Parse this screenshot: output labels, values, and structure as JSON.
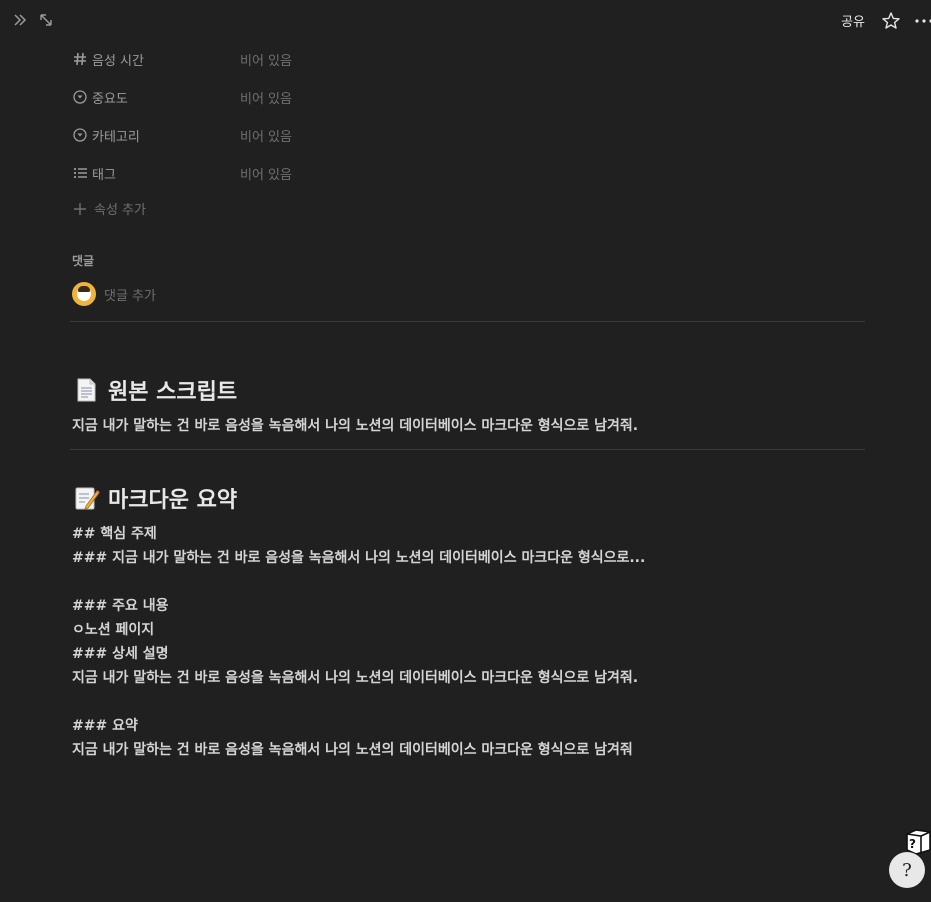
{
  "topbar": {
    "share_label": "공유"
  },
  "properties": [
    {
      "icon": "hash-icon",
      "name": "음성 시간",
      "value": "비어 있음"
    },
    {
      "icon": "select-icon",
      "name": "중요도",
      "value": "비어 있음"
    },
    {
      "icon": "select-icon",
      "name": "카테고리",
      "value": "비어 있음"
    },
    {
      "icon": "list-icon",
      "name": "태그",
      "value": "비어 있음"
    }
  ],
  "add_property_label": "속성 추가",
  "comments": {
    "label": "댓글",
    "placeholder": "댓글 추가"
  },
  "section1": {
    "emoji": "page-emoji",
    "title": "원본 스크립트",
    "text": "지금 내가 말하는 건 바로 음성을 녹음해서 나의 노션의 데이터베이스 마크다운 형식으로 남겨줘."
  },
  "section2": {
    "emoji": "memo-emoji",
    "title": "마크다운 요약",
    "lines": [
      "## 핵심 주제",
      "### 지금 내가 말하는 건 바로 음성을 녹음해서 나의 노션의 데이터베이스 마크다운 형식으로...",
      "",
      "### 주요 내용",
      "ㅇ노션 페이지",
      "### 상세 설명",
      "지금 내가 말하는 건 바로 음성을 녹음해서 나의 노션의 데이터베이스 마크다운 형식으로 남겨줘.",
      "",
      "### 요약",
      "지금 내가 말하는 건 바로 음성을 녹음해서 나의 노션의 데이터베이스 마크다운 형식으로 남겨줘"
    ]
  },
  "help_label": "?"
}
